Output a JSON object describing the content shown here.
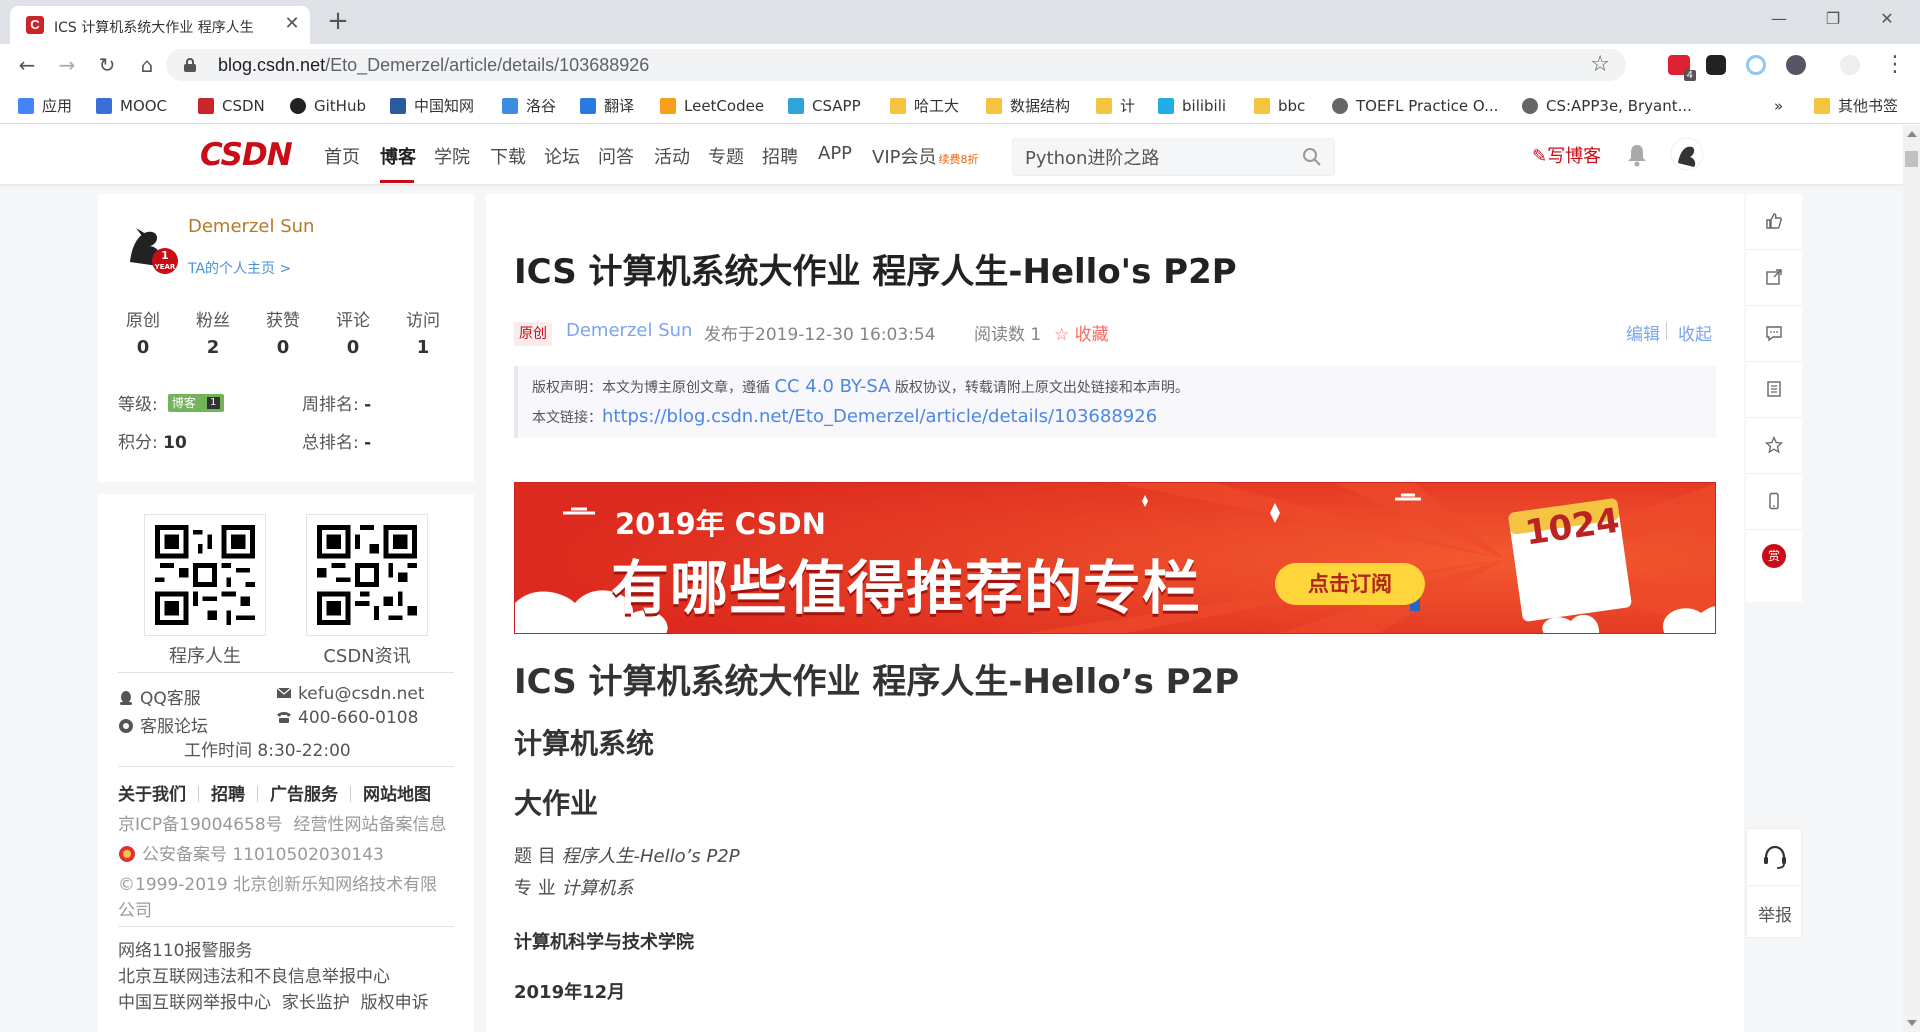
{
  "browser": {
    "tab_title": "ICS 计算机系统大作业 程序人生",
    "tab_close": "✕",
    "new_tab": "+",
    "url_host": "blog.csdn.net",
    "url_path": "/Eto_Demerzel/article/details/103688926",
    "ext_badge": "4",
    "bookmarks": [
      {
        "label": "应用",
        "icon": "apps-grid-icon",
        "color": "#4285f4"
      },
      {
        "label": "MOOC",
        "icon": "mooc-icon",
        "color": "#3b6fd4"
      },
      {
        "label": "CSDN",
        "icon": "csdn-icon",
        "color": "#c9252a"
      },
      {
        "label": "GitHub",
        "icon": "github-icon",
        "color": "#222222"
      },
      {
        "label": "中国知网",
        "icon": "cnki-icon",
        "color": "#2c5aa0"
      },
      {
        "label": "洛谷",
        "icon": "luogu-icon",
        "color": "#3b8de0"
      },
      {
        "label": "翻译",
        "icon": "translate-icon",
        "color": "#2a7ae2"
      },
      {
        "label": "LeetCodee",
        "icon": "leetcode-icon",
        "color": "#f89f1b"
      },
      {
        "label": "CSAPP",
        "icon": "csapp-icon",
        "color": "#2ea4d8"
      },
      {
        "label": "哈工大",
        "icon": "folder-icon",
        "color": "#f5c443"
      },
      {
        "label": "数据结构",
        "icon": "folder-icon",
        "color": "#f5c443"
      },
      {
        "label": "计",
        "icon": "folder-icon",
        "color": "#f5c443"
      },
      {
        "label": "bilibili",
        "icon": "bilibili-icon",
        "color": "#23ade5"
      },
      {
        "label": "bbc",
        "icon": "folder-icon",
        "color": "#f5c443"
      },
      {
        "label": "TOEFL Practice O...",
        "icon": "globe-icon",
        "color": "#666666"
      },
      {
        "label": "CS:APP3e, Bryant...",
        "icon": "globe-icon",
        "color": "#666666"
      }
    ],
    "more_bookmarks": "»",
    "other_bookmarks": "其他书签"
  },
  "csdn_header": {
    "logo": "CSDN",
    "nav": [
      "首页",
      "博客",
      "学院",
      "下载",
      "论坛",
      "问答",
      "活动",
      "专题",
      "招聘",
      "APP",
      "VIP会员"
    ],
    "vip_badge": "续费8折",
    "search_value": "Python进阶之路",
    "write_label": "写博客"
  },
  "profile": {
    "name": "Demerzel Sun",
    "home_link": "TA的个人主页 >",
    "year_badge": "1",
    "year_small": "YEAR",
    "stats": [
      {
        "label": "原创",
        "value": "0"
      },
      {
        "label": "粉丝",
        "value": "2"
      },
      {
        "label": "获赞",
        "value": "0"
      },
      {
        "label": "评论",
        "value": "0"
      },
      {
        "label": "访问",
        "value": "1"
      }
    ],
    "level_label": "等级:",
    "level_badge_text": "博客",
    "level_badge_num": "1",
    "weekly_rank_label": "周排名:",
    "weekly_rank_value": "-",
    "points_label": "积分:",
    "points_value": "10",
    "total_rank_label": "总排名:",
    "total_rank_value": "-"
  },
  "footer": {
    "qr_left_label": "程序人生",
    "qr_right_label": "CSDN资讯",
    "qq_service": "QQ客服",
    "email": "kefu@csdn.net",
    "forum": "客服论坛",
    "phone": "400-660-0108",
    "hours": "工作时间 8:30-22:00",
    "links": [
      "关于我们",
      "招聘",
      "广告服务",
      "网站地图"
    ],
    "icp": "京ICP备19004658号",
    "icp_info": "经营性网站备案信息",
    "police": "公安备案号 11010502030143",
    "copyright_1": "©1999-2019 北京创新乐知网络技术有限",
    "copyright_2": "公司",
    "report_1": "网络110报警服务",
    "report_2": "北京互联网违法和不良信息举报中心",
    "report_3a": "中国互联网举报中心",
    "report_3b": "家长监护",
    "report_3c": "版权申诉"
  },
  "article": {
    "title": "ICS 计算机系统大作业 程序人生-Hello's P2P",
    "original_tag": "原创",
    "author": "Demerzel Sun",
    "published": "发布于2019-12-30 16:03:54",
    "reads": "阅读数 1",
    "favorite": "☆ 收藏",
    "edit": "编辑",
    "favorite_right": "收起",
    "copyright_prefix": "版权声明：本文为博主原创文章，遵循",
    "license": "CC 4.0 BY-SA",
    "copyright_suffix": "版权协议，转载请附上原文出处链接和本声明。",
    "link_label": "本文链接：",
    "link_url": "https://blog.csdn.net/Eto_Demerzel/article/details/103688926",
    "banner_year": "2019年 CSDN",
    "banner_main": "有哪些值得推荐的专栏",
    "banner_button": "点击订阅",
    "banner_calendar": "1024",
    "h1": "ICS 计算机系统大作业 程序人生-Hello’s P2P",
    "h2_a": "计算机系统",
    "h2_b": "大作业",
    "topic_label": "题 目",
    "topic_value": "程序人生-Hello’s P2P",
    "major_label": "专 业",
    "major_value": "计算机系",
    "school": "计算机科学与技术学院",
    "date": "2019年12月"
  },
  "right_toolbar": {
    "reward": "赏",
    "report": "举报"
  },
  "colors": {
    "brand_red": "#ca0c16",
    "link_blue": "#4d87e4",
    "author_gold": "#b47a2a"
  }
}
